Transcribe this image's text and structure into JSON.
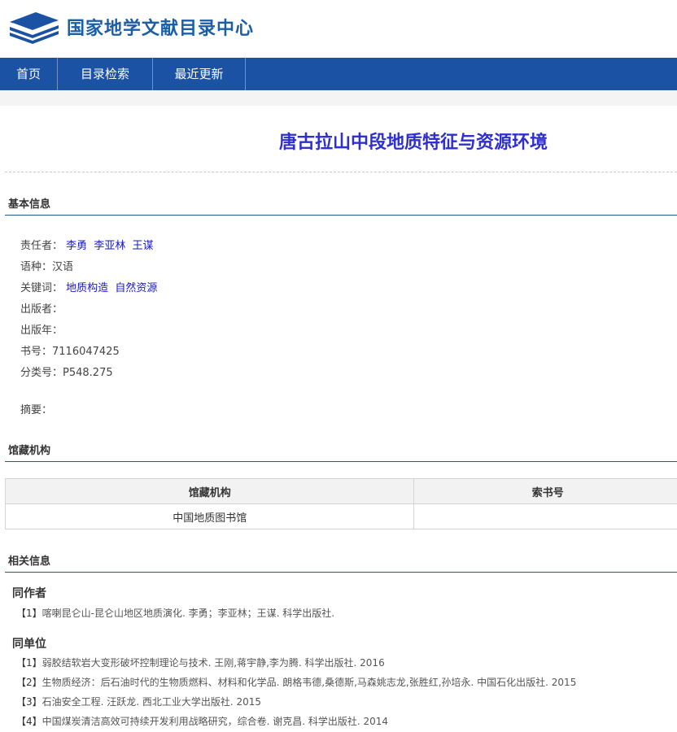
{
  "header": {
    "site_title": "国家地学文献目录中心"
  },
  "nav": {
    "items": [
      "首页",
      "目录检索",
      "最近更新"
    ]
  },
  "record": {
    "title": "唐古拉山中段地质特征与资源环境",
    "basic_section": "基本信息",
    "authors_label": "责任者：",
    "authors": [
      "李勇",
      "李亚林",
      "王谋"
    ],
    "language_label": "语种：",
    "language": "汉语",
    "keywords_label": "关键词：",
    "keywords": [
      "地质构造",
      "自然资源"
    ],
    "publisher_label": "出版者：",
    "publisher": "",
    "year_label": "出版年：",
    "year": "",
    "isbn_label": "书号：",
    "isbn": "7116047425",
    "class_label": "分类号：",
    "class_no": "P548.275",
    "abstract_label": "摘要：",
    "abstract": ""
  },
  "holdings": {
    "section": "馆藏机构",
    "columns": [
      "馆藏机构",
      "索书号"
    ],
    "rows": [
      [
        "中国地质图书馆",
        ""
      ]
    ]
  },
  "related": {
    "section": "相关信息",
    "coauthors_head": "同作者",
    "coauthors": [
      {
        "idx": "【1】",
        "text": "喀喇昆仑山-昆仑山地区地质演化. 李勇；李亚林；王谋. 科学出版社."
      }
    ],
    "sameunit_head": "同单位",
    "sameunit": [
      {
        "idx": "【1】",
        "text": "弱胶结软岩大变形破坏控制理论与技术. 王刚,蒋宇静,李为腾. 科学出版社. 2016"
      },
      {
        "idx": "【2】",
        "text": "生物质经济：后石油时代的生物质燃料、材料和化学品. 朗格韦德,桑德斯,马森姚志龙,张胜红,孙培永. 中国石化出版社. 2015"
      },
      {
        "idx": "【3】",
        "text": "石油安全工程. 汪跃龙. 西北工业大学出版社. 2015"
      },
      {
        "idx": "【4】",
        "text": "中国煤炭清洁高效可持续开发利用战略研究，综合卷. 谢克昌. 科学出版社. 2014"
      }
    ]
  }
}
